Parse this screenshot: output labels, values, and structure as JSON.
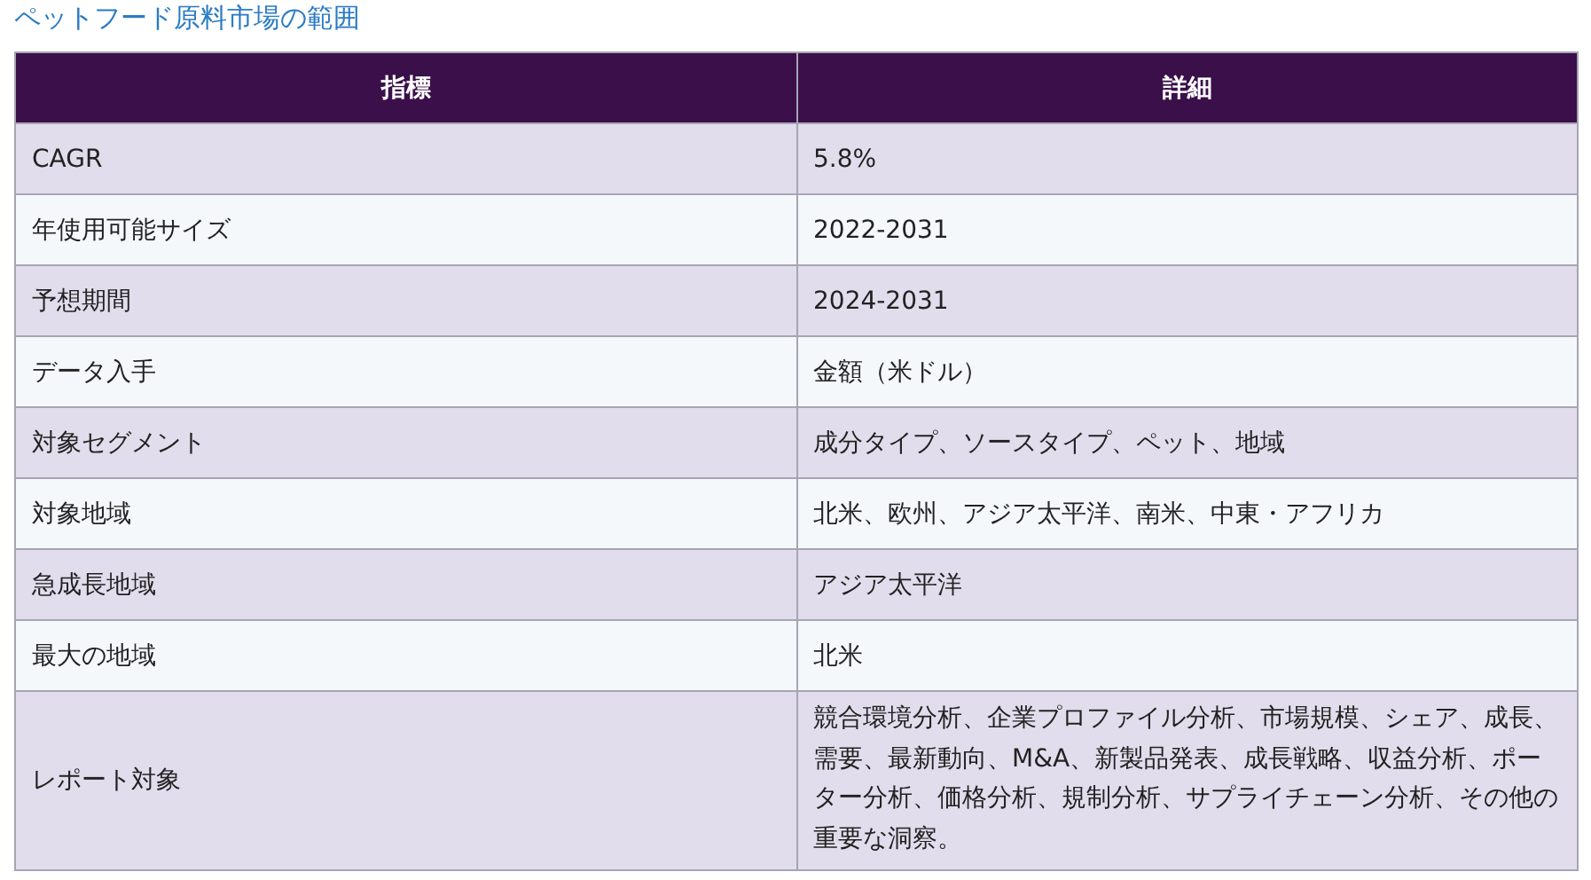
{
  "title": "ペットフード原料市場の範囲",
  "table": {
    "columns": [
      "指標",
      "詳細"
    ],
    "rows": [
      {
        "label": "CAGR",
        "value": "5.8%"
      },
      {
        "label": "年使用可能サイズ",
        "value": "2022-2031"
      },
      {
        "label": "予想期間",
        "value": "2024-2031"
      },
      {
        "label": "データ入手",
        "value": "金額（米ドル）"
      },
      {
        "label": "対象セグメント",
        "value": "成分タイプ、ソースタイプ、ペット、地域"
      },
      {
        "label": "対象地域",
        "value": "北米、欧州、アジア太平洋、南米、中東・アフリカ"
      },
      {
        "label": "急成長地域",
        "value": "アジア太平洋"
      },
      {
        "label": "最大の地域",
        "value": "北米"
      },
      {
        "label": "レポート対象",
        "value": "競合環境分析、企業プロファイル分析、市場規模、シェア、成長、需要、最新動向、M&A、新製品発表、成長戦略、収益分析、ポーター分析、価格分析、規制分析、サプライチェーン分析、その他の重要な洞察。"
      }
    ]
  }
}
